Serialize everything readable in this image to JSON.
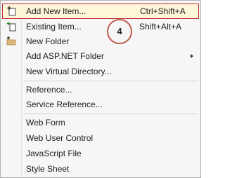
{
  "menu": {
    "items": [
      {
        "label": "Add New Item...",
        "shortcut": "Ctrl+Shift+A",
        "icon": "add-new-item-icon"
      },
      {
        "label": "Existing Item...",
        "shortcut": "Shift+Alt+A",
        "icon": "add-existing-item-icon"
      },
      {
        "label": "New Folder",
        "icon": "new-folder-icon"
      },
      {
        "label": "Add ASP.NET Folder",
        "submenu": true
      },
      {
        "label": "New Virtual Directory..."
      },
      {
        "label": "Reference..."
      },
      {
        "label": "Service Reference..."
      },
      {
        "label": "Web Form"
      },
      {
        "label": "Web User Control"
      },
      {
        "label": "JavaScript File"
      },
      {
        "label": "Style Sheet"
      }
    ]
  },
  "annotation": {
    "step_number": "4"
  },
  "colors": {
    "highlight_border": "#c0292e",
    "highlight_bg": "#fff6d9",
    "annotation_circle": "#c25a4e"
  }
}
